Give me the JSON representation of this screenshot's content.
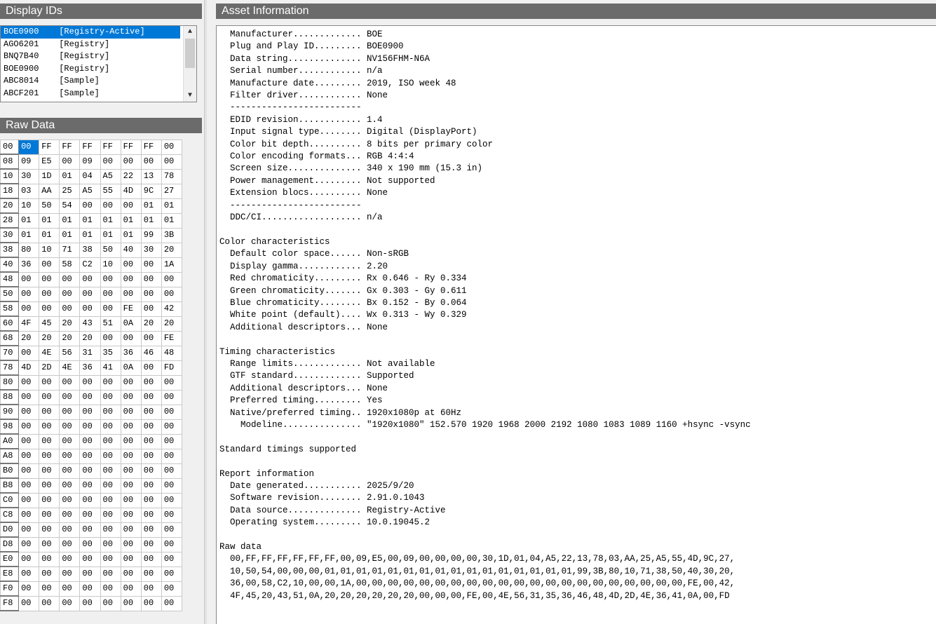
{
  "display_ids": {
    "title": "Display IDs",
    "items": [
      {
        "id": "BOE0900",
        "source": "[Registry-Active]",
        "selected": true
      },
      {
        "id": "AGO6201",
        "source": "[Registry]"
      },
      {
        "id": "BNQ7B40",
        "source": "[Registry]"
      },
      {
        "id": "BOE0900",
        "source": "[Registry]"
      },
      {
        "id": "ABC8014",
        "source": "[Sample]"
      },
      {
        "id": "ABCF201",
        "source": "[Sample]"
      }
    ]
  },
  "raw_data": {
    "title": "Raw Data",
    "rows": [
      {
        "addr": "00",
        "bytes": [
          "00",
          "FF",
          "FF",
          "FF",
          "FF",
          "FF",
          "FF",
          "00"
        ]
      },
      {
        "addr": "08",
        "bytes": [
          "09",
          "E5",
          "00",
          "09",
          "00",
          "00",
          "00",
          "00"
        ]
      },
      {
        "addr": "10",
        "bytes": [
          "30",
          "1D",
          "01",
          "04",
          "A5",
          "22",
          "13",
          "78"
        ]
      },
      {
        "addr": "18",
        "bytes": [
          "03",
          "AA",
          "25",
          "A5",
          "55",
          "4D",
          "9C",
          "27"
        ]
      },
      {
        "addr": "20",
        "bytes": [
          "10",
          "50",
          "54",
          "00",
          "00",
          "00",
          "01",
          "01"
        ]
      },
      {
        "addr": "28",
        "bytes": [
          "01",
          "01",
          "01",
          "01",
          "01",
          "01",
          "01",
          "01"
        ]
      },
      {
        "addr": "30",
        "bytes": [
          "01",
          "01",
          "01",
          "01",
          "01",
          "01",
          "99",
          "3B"
        ]
      },
      {
        "addr": "38",
        "bytes": [
          "80",
          "10",
          "71",
          "38",
          "50",
          "40",
          "30",
          "20"
        ]
      },
      {
        "addr": "40",
        "bytes": [
          "36",
          "00",
          "58",
          "C2",
          "10",
          "00",
          "00",
          "1A"
        ]
      },
      {
        "addr": "48",
        "bytes": [
          "00",
          "00",
          "00",
          "00",
          "00",
          "00",
          "00",
          "00"
        ]
      },
      {
        "addr": "50",
        "bytes": [
          "00",
          "00",
          "00",
          "00",
          "00",
          "00",
          "00",
          "00"
        ]
      },
      {
        "addr": "58",
        "bytes": [
          "00",
          "00",
          "00",
          "00",
          "00",
          "FE",
          "00",
          "42"
        ]
      },
      {
        "addr": "60",
        "bytes": [
          "4F",
          "45",
          "20",
          "43",
          "51",
          "0A",
          "20",
          "20"
        ]
      },
      {
        "addr": "68",
        "bytes": [
          "20",
          "20",
          "20",
          "20",
          "00",
          "00",
          "00",
          "FE"
        ]
      },
      {
        "addr": "70",
        "bytes": [
          "00",
          "4E",
          "56",
          "31",
          "35",
          "36",
          "46",
          "48"
        ]
      },
      {
        "addr": "78",
        "bytes": [
          "4D",
          "2D",
          "4E",
          "36",
          "41",
          "0A",
          "00",
          "FD"
        ]
      },
      {
        "addr": "80",
        "bytes": [
          "00",
          "00",
          "00",
          "00",
          "00",
          "00",
          "00",
          "00"
        ]
      },
      {
        "addr": "88",
        "bytes": [
          "00",
          "00",
          "00",
          "00",
          "00",
          "00",
          "00",
          "00"
        ]
      },
      {
        "addr": "90",
        "bytes": [
          "00",
          "00",
          "00",
          "00",
          "00",
          "00",
          "00",
          "00"
        ]
      },
      {
        "addr": "98",
        "bytes": [
          "00",
          "00",
          "00",
          "00",
          "00",
          "00",
          "00",
          "00"
        ]
      },
      {
        "addr": "A0",
        "bytes": [
          "00",
          "00",
          "00",
          "00",
          "00",
          "00",
          "00",
          "00"
        ]
      },
      {
        "addr": "A8",
        "bytes": [
          "00",
          "00",
          "00",
          "00",
          "00",
          "00",
          "00",
          "00"
        ]
      },
      {
        "addr": "B0",
        "bytes": [
          "00",
          "00",
          "00",
          "00",
          "00",
          "00",
          "00",
          "00"
        ]
      },
      {
        "addr": "B8",
        "bytes": [
          "00",
          "00",
          "00",
          "00",
          "00",
          "00",
          "00",
          "00"
        ]
      },
      {
        "addr": "C0",
        "bytes": [
          "00",
          "00",
          "00",
          "00",
          "00",
          "00",
          "00",
          "00"
        ]
      },
      {
        "addr": "C8",
        "bytes": [
          "00",
          "00",
          "00",
          "00",
          "00",
          "00",
          "00",
          "00"
        ]
      },
      {
        "addr": "D0",
        "bytes": [
          "00",
          "00",
          "00",
          "00",
          "00",
          "00",
          "00",
          "00"
        ]
      },
      {
        "addr": "D8",
        "bytes": [
          "00",
          "00",
          "00",
          "00",
          "00",
          "00",
          "00",
          "00"
        ]
      },
      {
        "addr": "E0",
        "bytes": [
          "00",
          "00",
          "00",
          "00",
          "00",
          "00",
          "00",
          "00"
        ]
      },
      {
        "addr": "E8",
        "bytes": [
          "00",
          "00",
          "00",
          "00",
          "00",
          "00",
          "00",
          "00"
        ]
      },
      {
        "addr": "F0",
        "bytes": [
          "00",
          "00",
          "00",
          "00",
          "00",
          "00",
          "00",
          "00"
        ]
      },
      {
        "addr": "F8",
        "bytes": [
          "00",
          "00",
          "00",
          "00",
          "00",
          "00",
          "00",
          "00"
        ]
      }
    ]
  },
  "asset_info": {
    "title": "Asset Information",
    "text": "  Manufacturer............. BOE\n  Plug and Play ID......... BOE0900\n  Data string.............. NV156FHM-N6A\n  Serial number............ n/a\n  Manufacture date......... 2019, ISO week 48\n  Filter driver............ None\n  -------------------------\n  EDID revision............ 1.4\n  Input signal type........ Digital (DisplayPort)\n  Color bit depth.......... 8 bits per primary color\n  Color encoding formats... RGB 4:4:4\n  Screen size.............. 340 x 190 mm (15.3 in)\n  Power management......... Not supported\n  Extension blocs.......... None\n  -------------------------\n  DDC/CI................... n/a\n\nColor characteristics\n  Default color space...... Non-sRGB\n  Display gamma............ 2.20\n  Red chromaticity......... Rx 0.646 - Ry 0.334\n  Green chromaticity....... Gx 0.303 - Gy 0.611\n  Blue chromaticity........ Bx 0.152 - By 0.064\n  White point (default).... Wx 0.313 - Wy 0.329\n  Additional descriptors... None\n\nTiming characteristics\n  Range limits............. Not available\n  GTF standard............. Supported\n  Additional descriptors... None\n  Preferred timing......... Yes\n  Native/preferred timing.. 1920x1080p at 60Hz\n    Modeline............... \"1920x1080\" 152.570 1920 1968 2000 2192 1080 1083 1089 1160 +hsync -vsync\n\nStandard timings supported\n\nReport information\n  Date generated........... 2025/9/20\n  Software revision........ 2.91.0.1043\n  Data source.............. Registry-Active\n  Operating system......... 10.0.19045.2\n\nRaw data\n  00,FF,FF,FF,FF,FF,FF,00,09,E5,00,09,00,00,00,00,30,1D,01,04,A5,22,13,78,03,AA,25,A5,55,4D,9C,27,\n  10,50,54,00,00,00,01,01,01,01,01,01,01,01,01,01,01,01,01,01,01,01,99,3B,80,10,71,38,50,40,30,20,\n  36,00,58,C2,10,00,00,1A,00,00,00,00,00,00,00,00,00,00,00,00,00,00,00,00,00,00,00,00,00,FE,00,42,\n  4F,45,20,43,51,0A,20,20,20,20,20,20,00,00,00,FE,00,4E,56,31,35,36,46,48,4D,2D,4E,36,41,0A,00,FD"
  },
  "colors": {
    "title_bar": "#6b6b6b",
    "selection": "#0078d7"
  }
}
